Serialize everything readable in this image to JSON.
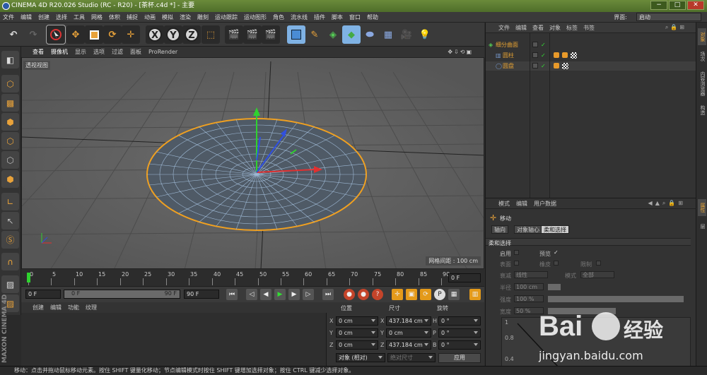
{
  "app": {
    "title": "CINEMA 4D R20.026 Studio (RC - R20) - [茶杯.c4d *] - 主要"
  },
  "window": {
    "minimize": "−",
    "maximize": "□",
    "close": "✕"
  },
  "menu": [
    "文件",
    "编辑",
    "创建",
    "选择",
    "工具",
    "网格",
    "体积",
    "捕捉",
    "动画",
    "模拟",
    "渲染",
    "雕刻",
    "运动跟踪",
    "运动图形",
    "角色",
    "流水线",
    "插件",
    "脚本",
    "窗口",
    "帮助"
  ],
  "interface": {
    "label": "界面:",
    "value": "启动"
  },
  "toolbar": {
    "x": "X",
    "y": "Y",
    "z": "Z"
  },
  "viewport": {
    "menu": [
      "查看",
      "摄像机",
      "显示",
      "选项",
      "过滤",
      "面板",
      "ProRender"
    ],
    "label": "透视视图",
    "grid": "网格间距 : 100 cm"
  },
  "timeline": {
    "ticks": [
      "0",
      "5",
      "10",
      "15",
      "20",
      "25",
      "30",
      "35",
      "40",
      "45",
      "50",
      "55",
      "60",
      "65",
      "70",
      "75",
      "80",
      "85",
      "90"
    ],
    "frame": "0 F"
  },
  "controls": {
    "start": "0 F",
    "range_start": "0 F",
    "range_end": "90 F",
    "end": "90 F"
  },
  "materials": {
    "menu": [
      "创建",
      "编辑",
      "功能",
      "纹理"
    ]
  },
  "coords": {
    "headers": [
      "位置",
      "尺寸",
      "旋转"
    ],
    "rows": [
      {
        "axis": "X",
        "pos": "0 cm",
        "size": "437.184 cm",
        "rlab": "H",
        "rot": "0 °"
      },
      {
        "axis": "Y",
        "pos": "0 cm",
        "size": "0 cm",
        "rlab": "P",
        "rot": "0 °"
      },
      {
        "axis": "Z",
        "pos": "0 cm",
        "size": "437.184 cm",
        "rlab": "B",
        "rot": "0 °"
      }
    ],
    "mode": "对象 (相对)",
    "sizemode": "绝对尺寸",
    "apply": "应用"
  },
  "objects": {
    "menu": [
      "文件",
      "编辑",
      "查看",
      "对象",
      "标签",
      "书签"
    ],
    "items": [
      {
        "name": "细分曲面"
      },
      {
        "name": "圆柱"
      },
      {
        "name": "圆盘"
      }
    ]
  },
  "right_tabs": [
    "对象",
    "场次",
    "内容浏览器",
    "构造",
    "属性",
    "层"
  ],
  "attributes": {
    "menu": [
      "模式",
      "编辑",
      "用户数据"
    ],
    "tool": "移动",
    "tabs": [
      "轴向",
      "对象轴心",
      "柔和选择"
    ],
    "section": "柔和选择",
    "enable": "启用",
    "preview": "预览",
    "surface": "表面",
    "rubber": "橡皮",
    "restrict": "限制",
    "mode_label": "衰减",
    "mode_value": "线性",
    "mode2_label": "模式",
    "mode2_value": "全部",
    "radius_label": "半径",
    "radius_value": "100 cm",
    "strength_label": "强度",
    "strength_value": "100 %",
    "width_label": "宽度",
    "width_value": "50 %",
    "graph_y1": "1",
    "graph_y2": "0.8",
    "graph_y3": "0.4"
  },
  "statusbar": "移动：点击并拖动鼠标移动元素。按住 SHIFT 键量化移动；节点编辑模式时按住 SHIFT 键增加选择对象；按住 CTRL 键减少选择对象。",
  "brand": "MAXON CINEMA 4D",
  "watermark": {
    "brand": "Bai",
    "brand2": "经验",
    "url": "jingyan.baidu.com"
  }
}
